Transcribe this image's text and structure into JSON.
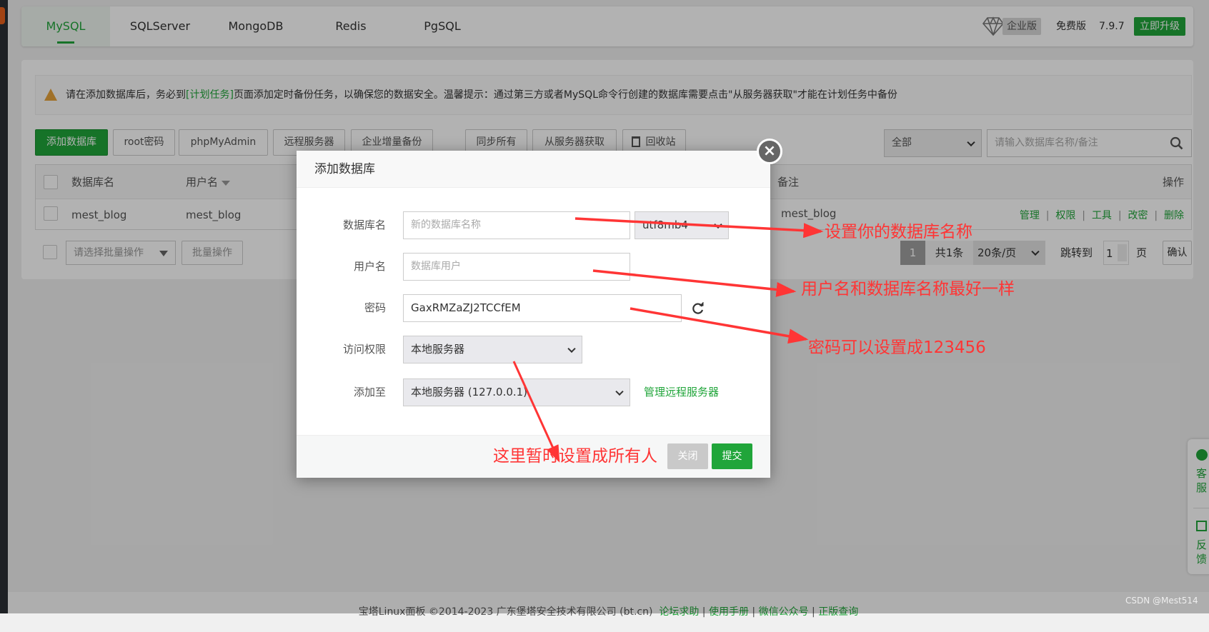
{
  "tabs": [
    {
      "label": "MySQL",
      "active": true
    },
    {
      "label": "SQLServer"
    },
    {
      "label": "MongoDB"
    },
    {
      "label": "Redis"
    },
    {
      "label": "PgSQL"
    }
  ],
  "header": {
    "enterprise_badge": "企业版",
    "edition": "免费版",
    "version": "7.9.7",
    "upgrade": "立即升级",
    "diamond_icon": "diamond-icon"
  },
  "alert": {
    "pre": "请在添加数据库后，务必到",
    "link": "[计划任务]",
    "post": "页面添加定时备份任务，以确保您的数据安全。温馨提示：通过第三方或者MySQL命令行创建的数据库需要点击\"从服务器获取\"才能在计划任务中备份"
  },
  "toolbar": {
    "add": "添加数据库",
    "root": "root密码",
    "pma": "phpMyAdmin",
    "remote": "远程服务器",
    "backup": "企业增量备份",
    "sync": "同步所有",
    "fetch": "从服务器获取",
    "recycle": "回收站",
    "filter": "全部",
    "search_placeholder": "请输入数据库名称/备注"
  },
  "table": {
    "headers": {
      "name": "数据库名",
      "user": "用户名",
      "note": "备注",
      "ops": "操作"
    },
    "rows": [
      {
        "name": "mest_blog",
        "user": "mest_blog",
        "note": "mest_blog",
        "actions": [
          "管理",
          "权限",
          "工具",
          "改密",
          "删除"
        ]
      }
    ]
  },
  "batch": {
    "select_placeholder": "请选择批量操作",
    "button": "批量操作"
  },
  "pagination": {
    "current": "1",
    "total": "共1条",
    "per_page": "20条/页",
    "jump": "跳转到",
    "page_input": "1",
    "page_unit": "页",
    "confirm": "确认"
  },
  "footer": {
    "copyright": "宝塔Linux面板 ©2014-2023 广东堡塔安全技术有限公司 (bt.cn)",
    "links": [
      "论坛求助",
      "使用手册",
      "微信公众号",
      "正版查询"
    ]
  },
  "float": {
    "service": "客服",
    "feedback": "反馈"
  },
  "watermark": "CSDN @Mest514",
  "dialog": {
    "title": "添加数据库",
    "fields": {
      "db_label": "数据库名",
      "db_placeholder": "新的数据库名称",
      "charset": "utf8mb4",
      "user_label": "用户名",
      "user_placeholder": "数据库用户",
      "pwd_label": "密码",
      "pwd_value": "GaxRMZaZJ2TCCfEM",
      "access_label": "访问权限",
      "access_value": "本地服务器",
      "addto_label": "添加至",
      "addto_value": "本地服务器 (127.0.0.1)",
      "manage_link": "管理远程服务器"
    },
    "close": "关闭",
    "submit": "提交"
  },
  "annotations": {
    "a1": "设置你的数据库名称",
    "a2": "用户名和数据库名称最好一样",
    "a3": "密码可以设置成123456",
    "a4": "这里暂时设置成所有人",
    "color": "#ff3535"
  },
  "colors": {
    "accent": "#20a53a"
  }
}
